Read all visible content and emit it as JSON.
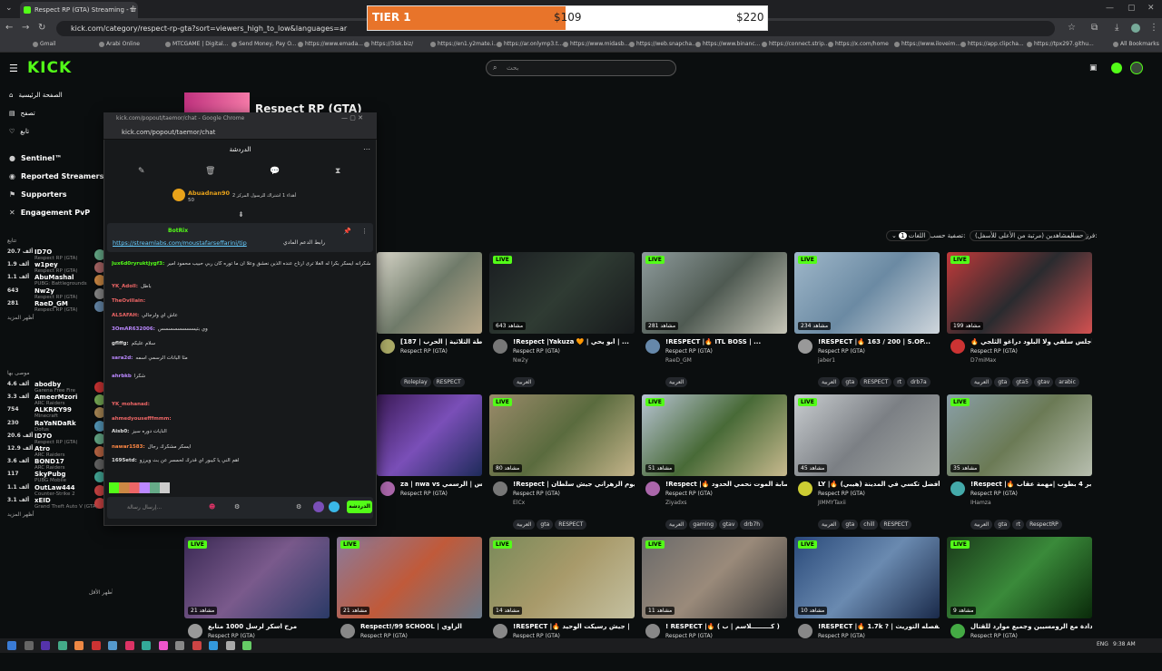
{
  "browser": {
    "tab_title": "Respect RP (GTA) Streaming - Li",
    "url": "kick.com/category/respect-rp-gta?sort=viewers_high_to_low&languages=ar",
    "bookmarks": [
      "Gmail",
      "Arabi Online",
      "MTCGAME | Digital...",
      "Send Money, Pay O...",
      "https://www.emada...",
      "https://3isk.biz/",
      "https://en1.y2mate.i...",
      "https://ar.onlymp3.t...",
      "https://www.midasb...",
      "https://web.snapcha...",
      "https://www.binanc...",
      "https://connect.strip...",
      "https://x.com/home",
      "https://www.iloveim...",
      "https://app.clipcha...",
      "https://tpx297.githu..."
    ],
    "all_bookmarks": "All Bookmarks"
  },
  "tier_overlay": {
    "label": "TIER 1",
    "progress": 0.495,
    "current": "$109",
    "goal": "$220",
    "fill_color": "#e8742a"
  },
  "header": {
    "logo": "KICK",
    "search_placeholder": "بحث"
  },
  "sidebar": {
    "nav": [
      "الصفحة الرئيسية",
      "تصفح",
      "تابع"
    ],
    "nav2": [
      "Sentinel™",
      "Reported Streamers",
      "Supporters",
      "Engagement PvP"
    ],
    "following_label": "تتابع",
    "following": [
      {
        "count": "20.7 ألف",
        "name": "ID7O",
        "game": "Respect RP (GTA)",
        "color": "#6a8"
      },
      {
        "count": "1.9 ألف",
        "name": "w1pey",
        "game": "Respect RP (GTA)",
        "color": "#a66"
      },
      {
        "count": "1.1 ألف",
        "name": "AbuMashal",
        "game": "PUBG: Battlegrounds",
        "color": "#c84"
      },
      {
        "count": "643",
        "name": "Nw2y",
        "game": "Respect RP (GTA)",
        "color": "#888"
      },
      {
        "count": "281",
        "name": "RaeD_GM",
        "game": "Respect RP (GTA)",
        "color": "#68a"
      }
    ],
    "show_more": "أظهر المزيد",
    "recommended_label": "موصى بها",
    "recommended": [
      {
        "count": "4.6 ألف",
        "name": "abodby",
        "game": "Garena Free Fire",
        "color": "#c33"
      },
      {
        "count": "3.3 ألف",
        "name": "AmeerMzori",
        "game": "ARC Raiders",
        "color": "#7a5"
      },
      {
        "count": "754",
        "name": "ALKRKY99",
        "game": "Minecraft",
        "color": "#a85"
      },
      {
        "count": "230",
        "name": "RaYaNDaRk",
        "game": "Dofus",
        "color": "#59b"
      },
      {
        "count": "20.6 ألف",
        "name": "ID7O",
        "game": "Respect RP (GTA)",
        "color": "#6a8"
      },
      {
        "count": "12.9 ألف",
        "name": "Atro",
        "game": "ARC Raiders",
        "color": "#b64"
      },
      {
        "count": "3.6 ألف",
        "name": "BOND17",
        "game": "ARC Raiders",
        "color": "#666"
      },
      {
        "count": "117",
        "name": "SkyPubg",
        "game": "PUBG Mobile",
        "color": "#4a9"
      },
      {
        "count": "1.1 ألف",
        "name": "OutLaw444",
        "game": "Counter-Strike 2",
        "color": "#c44"
      },
      {
        "count": "3.1 ألف",
        "name": "xEID",
        "game": "Grand Theft Auto V (GTA)",
        "color": "#c44"
      }
    ],
    "show_more2": "أظهر المزيد",
    "show_less": "أظهر الأقل"
  },
  "category": {
    "name": "Respect RP (GTA)"
  },
  "filters": {
    "sort_label": "فرز حسب:",
    "sort_value": "المشاهدين (مرتبة من الأعلى للأسفل)",
    "filter_label": "تصفية حسب:",
    "language_label": "اللغات",
    "language_count": "1"
  },
  "popout": {
    "window_title": "kick.com/popout/taemor/chat - Google Chrome",
    "url": "kick.com/popout/taemor/chat",
    "header": "الدردشة",
    "gifter": {
      "name": "Abuadnan90",
      "amount": "50",
      "note": "أهداء 1 اشتراك للرسول المركز 2"
    },
    "pinned_user": "BotRix",
    "pinned_link": "https://streamlabs.com/moustafarseffarini/tip",
    "pinned_text": "رابط الدعم المادي",
    "messages": [
      {
        "user": "Jux6d0ryruktjygf3:",
        "text": "يا خوان تزلت الشكرانه ايسكر بكرا له الغلا ترى ارتاح عنده الذين نعشق وعلا ان ما توره كان ربي حبيب محمود امير",
        "color": "#53fc18"
      },
      {
        "user": "YK_Adoll:",
        "text": "باطل",
        "color": "#e66"
      },
      {
        "user": "TheOvillain:",
        "text": "",
        "color": "#e66"
      },
      {
        "user": "ALSAFAH:",
        "text": "عاش اي ولرجالي",
        "color": "#e66"
      },
      {
        "user": "3OmAR632006:",
        "text": "وي بتيسسسسسسسس",
        "color": "#b8f"
      },
      {
        "user": "gflffg:",
        "text": "سلام عليكم",
        "color": "#ddd"
      },
      {
        "user": "sara2d:",
        "text": "مثا البانات الرسمي اسمه",
        "color": "#b8f"
      },
      {
        "user": "ahrbkb",
        "text": "شكراً",
        "color": "#b8f"
      },
      {
        "user": "YK_mohanad:",
        "text": "",
        "color": "#e66"
      },
      {
        "user": "ahmedyousefffmmm:",
        "text": "",
        "color": "#e66"
      },
      {
        "user": "Aisb0:",
        "text": "النايات دوره سيز",
        "color": "#ddd"
      },
      {
        "user": "nawar1583:",
        "text": "ايسكر مشكرك رجال",
        "color": "#f84"
      },
      {
        "user": "1695etd:",
        "text": "اهم الني يا كيبور اي قدرك لحمسر عن بث ويرزو",
        "color": "#ddd"
      }
    ],
    "input_placeholder": "إرسال رسالة...",
    "send_label": "الدردشة"
  },
  "cards": [
    {
      "title": "[187 | الشرطة الثلاثية | الحرب 💥 | ...",
      "category": "Respect RP (GTA)",
      "user": "",
      "views": "",
      "live": false,
      "tags": [
        "Roleplay",
        "RESPECT"
      ],
      "bg": "linear-gradient(135deg,#d8d6c9,#6f7a69,#b9a98a)",
      "av": "#aa6"
    },
    {
      "title": "!Respect |Yakuza 🧡 | أبو يحي | ...",
      "category": "Respect RP (GTA)",
      "user": "Nw2y",
      "views": "643 مشاهد",
      "live": true,
      "tags": [
        "العربية"
      ],
      "bg": "linear-gradient(135deg,#1a1d21,#2f3b33,#171a1c)",
      "av": "#777"
    },
    {
      "title": "!RESPECT |🔥 ITL BOSS | ...",
      "category": "Respect RP (GTA)",
      "user": "RaeD_GM",
      "views": "281 مشاهد",
      "live": true,
      "tags": [
        "العربية"
      ],
      "bg": "linear-gradient(135deg,#8e9b9c,#4f5a52,#c7c6b8)",
      "av": "#68a"
    },
    {
      "title": "!RESPECT |🔥 163 / 200 | S.OP...",
      "category": "Respect RP (GTA)",
      "user": "jaber1",
      "views": "234 مشاهد",
      "live": true,
      "tags": [
        "العربية",
        "gta",
        "RESPECT",
        "rt",
        "drb7a"
      ],
      "bg": "linear-gradient(135deg,#9fb7c9,#6b8aa3,#cfd6dc)",
      "av": "#999"
    },
    {
      "title": "🔥 أجلس سلفي ولا البلود دراغو الثلجي 🔥",
      "category": "Respect RP (GTA)",
      "user": "D7miMax",
      "views": "199 مشاهد",
      "live": true,
      "tags": [
        "العربية",
        "gta",
        "gta5",
        "gtav",
        "arabic"
      ],
      "bg": "linear-gradient(135deg,#c23a3a,#2a2b2f,#d35151)",
      "av": "#c33"
    },
    {
      "title": "za | nwa vs البائس | الرسمي ...",
      "category": "Respect RP (GTA)",
      "user": "",
      "views": "",
      "live": false,
      "tags": [],
      "bg": "linear-gradient(135deg,#3c1b58,#7a4fb8,#1e2b5a)",
      "av": "#a6a"
    },
    {
      "title": "!Respect | الحرب اليوم الزهراني جيش سلطان |",
      "category": "Respect RP (GTA)",
      "user": "ElCx",
      "views": "80 مشاهد",
      "live": true,
      "tags": [
        "العربية",
        "gta",
        "RESPECT"
      ],
      "bg": "linear-gradient(135deg,#9a8a6a,#5a6b3e,#c4b48a)",
      "av": "#777"
    },
    {
      "title": "!Respect |🔥 عصابة الموت نحمي الحدود...",
      "category": "Respect RP (GTA)",
      "user": "Ziyadxs",
      "views": "51 مشاهد",
      "live": true,
      "tags": [
        "العربية",
        "gaming",
        "gtav",
        "drb7h"
      ],
      "bg": "linear-gradient(135deg,#b8c4d4,#486a37,#c7b98e)",
      "av": "#a6a"
    },
    {
      "title": "LY |🔥 أفضل تكسي في المدينة (هيبي)",
      "category": "Respect RP (GTA)",
      "user": "JIMMYTaxii",
      "views": "45 مشاهد",
      "live": true,
      "tags": [
        "العربية",
        "gta",
        "chill",
        "RESPECT"
      ],
      "bg": "linear-gradient(135deg,#c9cdd0,#7b7f84,#a5a9a6)",
      "av": "#cc3"
    },
    {
      "title": "!Respect |🔥 بر 4 بطوب |مهمة عقاب",
      "category": "Respect RP (GTA)",
      "user": "IHamza",
      "views": "35 مشاهد",
      "live": true,
      "tags": [
        "العربية",
        "gta",
        "rt",
        "RespectRP"
      ],
      "bg": "linear-gradient(135deg,#8aa0a8,#6b7a55,#b8bfb0)",
      "av": "#4aa"
    },
    {
      "title": "مرح آسكر لرسل 1000 متابع",
      "category": "Respect RP (GTA)",
      "user": "",
      "views": "21 مشاهد",
      "live": true,
      "tags": [],
      "bg": "linear-gradient(135deg,#3b2a55,#7a5a8c,#2a3a66)",
      "av": "#999"
    },
    {
      "title": "Respect!/99 SCHOOL | الزاوي",
      "category": "Respect RP (GTA)",
      "user": "",
      "views": "21 مشاهد",
      "live": true,
      "tags": [],
      "bg": "linear-gradient(135deg,#8a7b9c,#c05a3a,#6a7a8a)",
      "av": "#888"
    },
    {
      "title": "!RESPECT |🔥 جيش رسيكت الوحيد |",
      "category": "Respect RP (GTA)",
      "user": "",
      "views": "14 مشاهد",
      "live": true,
      "tags": [],
      "bg": "linear-gradient(135deg,#7a8a5a,#a89a6a,#c4c0a0)",
      "av": "#888"
    },
    {
      "title": "! RESPECT |🔥 ( كـــــــــلاسم | ب )",
      "category": "Respect RP (GTA)",
      "user": "",
      "views": "11 مشاهد",
      "live": true,
      "tags": [],
      "bg": "linear-gradient(135deg,#6a6a6a,#9a8a7a,#3a3a3a)",
      "av": "#888"
    },
    {
      "title": "!RESPECT |🔥 1.7k ? | الفصله التوريث",
      "category": "Respect RP (GTA)",
      "user": "",
      "views": "10 مشاهد",
      "live": true,
      "tags": [],
      "bg": "linear-gradient(135deg,#2a4a7a,#6a8ab0,#1a2a4a)",
      "av": "#888"
    },
    {
      "title": "الدادة مع الرومسيين وجميع موارد للقتال",
      "category": "Respect RP (GTA)",
      "user": "",
      "views": "9 مشاهد",
      "live": true,
      "tags": [],
      "bg": "linear-gradient(135deg,#1a3a1a,#3a8a3a,#0a2a0a)",
      "av": "#4a4"
    }
  ],
  "taskbar": {
    "lang": "ENG",
    "time": "9:38 AM"
  }
}
